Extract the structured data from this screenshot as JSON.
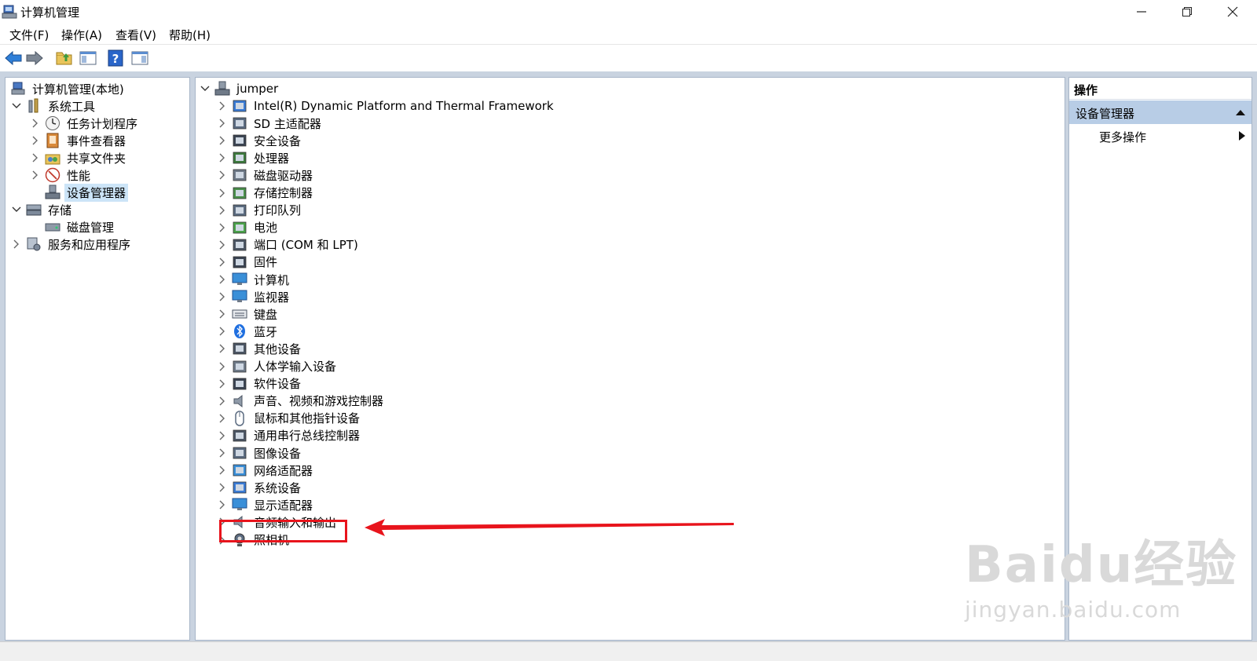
{
  "window": {
    "title": "计算机管理"
  },
  "menu": [
    "文件(F)",
    "操作(A)",
    "查看(V)",
    "帮助(H)"
  ],
  "left_tree": [
    {
      "label": "计算机管理(本地)",
      "icon": "computer-management-icon",
      "chevron": "",
      "indent": 0
    },
    {
      "label": "系统工具",
      "icon": "system-tools-icon",
      "chevron": "down",
      "indent": 1
    },
    {
      "label": "任务计划程序",
      "icon": "clock-icon",
      "chevron": "right",
      "indent": 2
    },
    {
      "label": "事件查看器",
      "icon": "event-viewer-icon",
      "chevron": "right",
      "indent": 2
    },
    {
      "label": "共享文件夹",
      "icon": "shared-folder-icon",
      "chevron": "right",
      "indent": 2
    },
    {
      "label": "性能",
      "icon": "performance-icon",
      "chevron": "right",
      "indent": 2
    },
    {
      "label": "设备管理器",
      "icon": "device-manager-icon",
      "chevron": "",
      "indent": 2,
      "selected": true
    },
    {
      "label": "存储",
      "icon": "storage-icon",
      "chevron": "down",
      "indent": 1
    },
    {
      "label": "磁盘管理",
      "icon": "disk-management-icon",
      "chevron": "",
      "indent": 2
    },
    {
      "label": "服务和应用程序",
      "icon": "services-icon",
      "chevron": "right",
      "indent": 1
    }
  ],
  "device_root": "jumper",
  "devices": [
    {
      "label": "Intel(R) Dynamic Platform and Thermal Framework",
      "icon": "chip-folder-icon"
    },
    {
      "label": "SD 主适配器",
      "icon": "sd-card-icon"
    },
    {
      "label": "安全设备",
      "icon": "security-device-icon"
    },
    {
      "label": "处理器",
      "icon": "processor-icon"
    },
    {
      "label": "磁盘驱动器",
      "icon": "disk-drive-icon"
    },
    {
      "label": "存储控制器",
      "icon": "storage-controller-icon"
    },
    {
      "label": "打印队列",
      "icon": "printer-icon"
    },
    {
      "label": "电池",
      "icon": "battery-icon"
    },
    {
      "label": "端口 (COM 和 LPT)",
      "icon": "port-icon"
    },
    {
      "label": "固件",
      "icon": "firmware-icon"
    },
    {
      "label": "计算机",
      "icon": "computer-icon"
    },
    {
      "label": "监视器",
      "icon": "monitor-icon"
    },
    {
      "label": "键盘",
      "icon": "keyboard-icon"
    },
    {
      "label": "蓝牙",
      "icon": "bluetooth-icon"
    },
    {
      "label": "其他设备",
      "icon": "other-device-icon"
    },
    {
      "label": "人体学输入设备",
      "icon": "hid-icon"
    },
    {
      "label": "软件设备",
      "icon": "software-device-icon"
    },
    {
      "label": "声音、视频和游戏控制器",
      "icon": "speaker-icon"
    },
    {
      "label": "鼠标和其他指针设备",
      "icon": "mouse-icon"
    },
    {
      "label": "通用串行总线控制器",
      "icon": "usb-icon"
    },
    {
      "label": "图像设备",
      "icon": "imaging-device-icon"
    },
    {
      "label": "网络适配器",
      "icon": "network-adapter-icon"
    },
    {
      "label": "系统设备",
      "icon": "system-device-icon"
    },
    {
      "label": "显示适配器",
      "icon": "display-adapter-icon"
    },
    {
      "label": "音频输入和输出",
      "icon": "audio-io-icon"
    },
    {
      "label": "照相机",
      "icon": "camera-icon"
    }
  ],
  "actions": {
    "header": "操作",
    "section": "设备管理器",
    "more": "更多操作"
  },
  "watermark": {
    "main": "Baidu经验",
    "sub": "jingyan.baidu.com"
  },
  "colors": {
    "accent": "#b8cde6",
    "selection": "#cce4f7",
    "annotation": "#e8141c"
  }
}
